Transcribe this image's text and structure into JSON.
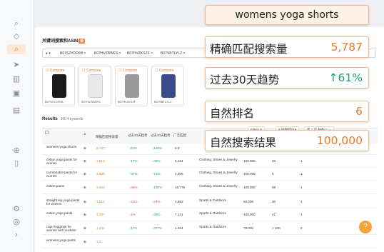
{
  "header": {
    "title": "关键词搜索和ASIN",
    "badge": "新"
  },
  "search": {
    "flag_icon": "us-flag-icon",
    "asins": [
      "B07SZYDFKB",
      "B07HVZBWFS",
      "B07HVZKSZF",
      "B07SBTLYLZ"
    ]
  },
  "compare": {
    "label": "Compare",
    "asins": [
      "B07SZYDFKB",
      "B07HVZBWFS",
      "B07HVZKSZF",
      "B07SBTLYLZ"
    ]
  },
  "results": {
    "label": "Results",
    "count": "360 Keywords"
  },
  "toolbar": {
    "filters": "Filters",
    "time": "8 日期时间",
    "page_prefix": "第",
    "page": "1",
    "page_of": "页,共有 2"
  },
  "columns": [
    "精确匹配搜索量",
    "过去30天趋势",
    "过去30天趋势",
    "广泛匹配",
    "类目",
    "",
    "自然排名",
    ""
  ],
  "rows": [
    {
      "keyword": "womens yoga shorts",
      "volume": "5,787",
      "trend1": "↑61%",
      "trend1_dir": "up",
      "trend2": "↑126%",
      "trend2_dir": "up",
      "broad": "6,3",
      "category": "",
      "results": "",
      "rank": "",
      "extra": ""
    },
    {
      "keyword": "cotton yoga pants for women",
      "volume": "3,613",
      "trend1": "↑17%",
      "trend1_dir": "up",
      "trend2": "↑46%",
      "trend2_dir": "up",
      "broad": "5,164",
      "category": "Clothing, Shoes & Jewelry",
      "results": "100,000",
      "rank": "20",
      "extra": "1"
    },
    {
      "keyword": "comfortable pants for women",
      "volume": "2,589",
      "trend1": "↑37%",
      "trend1_dir": "up",
      "trend2": "↑73%",
      "trend2_dir": "up",
      "broad": "4,206",
      "category": "Clothing, Shoes & Jewelry",
      "results": "100,000",
      "rank": "6",
      "extra": "1"
    },
    {
      "keyword": "cotton pants",
      "volume": "1,543",
      "trend1": "↓46%",
      "trend1_dir": "down",
      "trend2": "↑100%",
      "trend2_dir": "up",
      "broad": "18,779",
      "category": "Clothing, Shoes & Jewelry",
      "results": "100,000",
      "rank": "68",
      "extra": "1"
    },
    {
      "keyword": "straight leg yoga pants for women",
      "volume": "1,512",
      "trend1": "↓12%",
      "trend1_dir": "down",
      "trend2": "↓24%",
      "trend2_dir": "down",
      "broad": "1,682",
      "category": "Sports & Outdoors",
      "results": "50,000",
      "rank": "30",
      "extra": "1"
    },
    {
      "keyword": "cotton yoga pants",
      "volume": "1,387",
      "trend1": "↓1%",
      "trend1_dir": "down",
      "trend2": "↑29%",
      "trend2_dir": "up",
      "broad": "7,141",
      "category": "Sports & Outdoors",
      "results": "100,000",
      "rank": "41",
      "extra": "1"
    },
    {
      "keyword": "capri leggings for women with pockets",
      "volume": "1,344",
      "trend1": "↑17%",
      "trend1_dir": "up",
      "trend2": "↑377%",
      "trend2_dir": "up",
      "broad": "1,494",
      "category": "Sports & Outdoors",
      "results": "70,000",
      "rank": "> 100",
      "extra": "2"
    },
    {
      "keyword": "womens yoga pants",
      "volume": "1,2..",
      "trend1": "",
      "trend1_dir": "up",
      "trend2": "",
      "trend2_dir": "up",
      "broad": "",
      "category": "",
      "results": "",
      "rank": "",
      "extra": ""
    }
  ],
  "overlay": {
    "title": "womens yoga shorts",
    "stats": [
      {
        "label": "精确匹配搜索量",
        "value": "5,787",
        "color": "#e8792a"
      },
      {
        "label": "过去30天趋势",
        "value": "↑61%",
        "color": "#1aa36b"
      },
      {
        "label": "自然排名",
        "value": "6",
        "color": "#e8792a"
      },
      {
        "label": "自然搜索结果",
        "value": "100,000",
        "color": "#e8792a"
      }
    ]
  },
  "colors": {
    "accent": "#e8792a",
    "up": "#1aa36b",
    "down": "#e54545"
  },
  "help": {
    "icon": "question-icon",
    "label": "?"
  }
}
